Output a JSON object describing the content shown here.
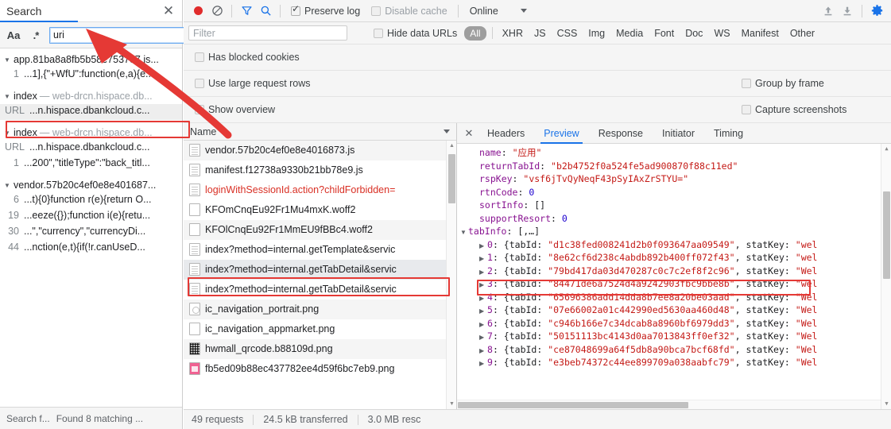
{
  "search_panel": {
    "title": "Search",
    "close_icon": "close-icon",
    "toolbar": {
      "match_case_icon": "Aa",
      "regex_icon": ".*",
      "query_value": "uri",
      "query_placeholder": "",
      "refresh_icon": "refresh-icon",
      "clear_icon": "clear-icon"
    },
    "results": [
      {
        "type": "file",
        "name": "app.81ba8a8fb5b58e7537e7.js...",
        "domain": ""
      },
      {
        "type": "line",
        "lineno": "1",
        "text": "...1],{\"+WfU\":function(e,a){e..."
      },
      {
        "type": "gap"
      },
      {
        "type": "file",
        "name": "index",
        "domain": "— web-drcn.hispace.db..."
      },
      {
        "type": "line",
        "lineno": "URL",
        "text": "...n.hispace.dbankcloud.c...",
        "highlight": true
      },
      {
        "type": "gap"
      },
      {
        "type": "file",
        "name": "index",
        "domain": "— web-drcn.hispace.db..."
      },
      {
        "type": "line",
        "lineno": "URL",
        "text": "...n.hispace.dbankcloud.c..."
      },
      {
        "type": "line",
        "lineno": "1",
        "text": "...200\",\"titleType\":\"back_titl..."
      },
      {
        "type": "gap"
      },
      {
        "type": "file",
        "name": "vendor.57b20c4ef0e8e401687...",
        "domain": ""
      },
      {
        "type": "line",
        "lineno": "6",
        "text": "...t){0}function r(e){return O..."
      },
      {
        "type": "line",
        "lineno": "19",
        "text": "...eeze({});function i(e){retu..."
      },
      {
        "type": "line",
        "lineno": "30",
        "text": "...\",\"currency\",\"currencyDi..."
      },
      {
        "type": "line",
        "lineno": "44",
        "text": "...nction(e,t){if(!r.canUseD..."
      }
    ],
    "footer": {
      "search_label": "Search f...",
      "found_label": "Found 8 matching ..."
    }
  },
  "network": {
    "toolbar": {
      "record_icon": "record-icon",
      "clear_icon": "clear-icon",
      "filter_icon": "filter-icon",
      "search_icon": "search-icon",
      "preserve_log_label": "Preserve log",
      "preserve_log_checked": true,
      "disable_cache_label": "Disable cache",
      "disable_cache_checked": false,
      "throttle_value": "Online",
      "import_icon": "upload-icon",
      "export_icon": "download-icon",
      "settings_icon": "gear-icon",
      "settings_color": "#1a73e8"
    },
    "filter_row": {
      "filter_placeholder": "Filter",
      "filter_value": "",
      "hide_data_urls_label": "Hide data URLs",
      "hide_data_urls_checked": false,
      "types": [
        "All",
        "XHR",
        "JS",
        "CSS",
        "Img",
        "Media",
        "Font",
        "Doc",
        "WS",
        "Manifest",
        "Other"
      ],
      "selected_type": "All"
    },
    "options": {
      "has_blocked_cookies_label": "Has blocked cookies",
      "has_blocked_cookies_checked": false,
      "use_large_request_rows_label": "Use large request rows",
      "use_large_request_rows_checked": false,
      "group_by_frame_label": "Group by frame",
      "group_by_frame_checked": false,
      "show_overview_label": "Show overview",
      "show_overview_checked": false,
      "capture_screenshots_label": "Capture screenshots",
      "capture_screenshots_checked": false
    },
    "list": {
      "column_header": "Name",
      "sort_icon": "chevron-down-icon",
      "rows": [
        {
          "name": "vendor.57b20c4ef0e8e4016873.js",
          "icon": "document-icon",
          "state": "alt"
        },
        {
          "name": "manifest.f12738a9330b21bb78e9.js",
          "icon": "document-icon",
          "state": "normal"
        },
        {
          "name": "loginWithSessionId.action?childForbidden=",
          "icon": "document-icon",
          "state": "error"
        },
        {
          "name": "KFOmCnqEu92Fr1Mu4mxK.woff2",
          "icon": "font-icon",
          "state": "normal"
        },
        {
          "name": "KFOlCnqEu92Fr1MmEU9fBBc4.woff2",
          "icon": "font-icon",
          "state": "alt"
        },
        {
          "name": "index?method=internal.getTemplate&servic",
          "icon": "document-icon",
          "state": "normal"
        },
        {
          "name": "index?method=internal.getTabDetail&servic",
          "icon": "document-icon",
          "state": "selected"
        },
        {
          "name": "index?method=internal.getTabDetail&servic",
          "icon": "document-icon",
          "state": "normal"
        },
        {
          "name": "ic_navigation_portrait.png",
          "icon": "image-icon",
          "state": "alt"
        },
        {
          "name": "ic_navigation_appmarket.png",
          "icon": "image-icon",
          "state": "normal"
        },
        {
          "name": "hwmall_qrcode.b88109d.png",
          "icon": "qr-image-icon",
          "state": "alt"
        },
        {
          "name": "fb5ed09b88ec437782ee4d59f6bc7eb9.png",
          "icon": "image-icon",
          "state": "normal"
        }
      ]
    },
    "details": {
      "close_icon": "close-icon",
      "tabs": [
        "Headers",
        "Preview",
        "Response",
        "Initiator",
        "Timing"
      ],
      "active_tab": "Preview",
      "preview_lines": [
        {
          "indent": 1,
          "key": "name",
          "value": "\"应用\"",
          "vtype": "string"
        },
        {
          "indent": 1,
          "key": "returnTabId",
          "value": "\"b2b4752f0a524fe5ad900870f88c11ed\"",
          "vtype": "string"
        },
        {
          "indent": 1,
          "key": "rspKey",
          "value": "\"vsf6jTvQyNeqF43pSyIAxZrSTYU=\"",
          "vtype": "string"
        },
        {
          "indent": 1,
          "key": "rtnCode",
          "value": "0",
          "vtype": "num"
        },
        {
          "indent": 1,
          "key": "sortInfo",
          "value": "[]",
          "vtype": "plain"
        },
        {
          "indent": 1,
          "key": "supportResort",
          "value": "0",
          "vtype": "num"
        },
        {
          "indent": 0,
          "arrow": "▼",
          "key": "tabInfo",
          "value": "[,…]",
          "vtype": "plain"
        },
        {
          "indent": 1,
          "arrow": "▶",
          "idx": "0",
          "value": "{tabId: \"d1c38fed008241d2b0f093647aa09549\", statKey: \"wel",
          "vtype": "entry"
        },
        {
          "indent": 1,
          "arrow": "▶",
          "idx": "1",
          "value": "{tabId: \"8e62cf6d238c4abdb892b400ff072f43\", statKey: \"wel",
          "vtype": "entry",
          "highlight": true
        },
        {
          "indent": 1,
          "arrow": "▶",
          "idx": "2",
          "value": "{tabId: \"79bd417da03d470287c0c7c2ef8f2c96\", statKey: \"Wel",
          "vtype": "entry"
        },
        {
          "indent": 1,
          "arrow": "▶",
          "idx": "3",
          "value": "{tabId: \"84471de6a7524d4a9242903fbc9bbe8b\", statKey: \"wel",
          "vtype": "entry"
        },
        {
          "indent": 1,
          "arrow": "▶",
          "idx": "4",
          "value": "{tabId: \"65696386add14dda8b7ee8a20be03aad\", statKey: \"Wel",
          "vtype": "entry"
        },
        {
          "indent": 1,
          "arrow": "▶",
          "idx": "5",
          "value": "{tabId: \"07e66002a01c442990ed5630aa460d48\", statKey: \"Wel",
          "vtype": "entry"
        },
        {
          "indent": 1,
          "arrow": "▶",
          "idx": "6",
          "value": "{tabId: \"c946b166e7c34dcab8a8960bf6979dd3\", statKey: \"Wel",
          "vtype": "entry"
        },
        {
          "indent": 1,
          "arrow": "▶",
          "idx": "7",
          "value": "{tabId: \"50151113bc4143d0aa7013843ff0ef32\", statKey: \"Wel",
          "vtype": "entry"
        },
        {
          "indent": 1,
          "arrow": "▶",
          "idx": "8",
          "value": "{tabId: \"ce87048699a64f5db8a90bca7bcf68fd\", statKey: \"Wel",
          "vtype": "entry"
        },
        {
          "indent": 1,
          "arrow": "▶",
          "idx": "9",
          "value": "{tabId: \"e3beb74372c44ee899709a038aabfc79\", statKey: \"Wel",
          "vtype": "entry"
        }
      ]
    },
    "footer": {
      "requests": "49 requests",
      "transferred": "24.5 kB transferred",
      "resources": "3.0 MB resc"
    }
  },
  "accent": "#1a73e8",
  "annotation_color": "#e53935"
}
